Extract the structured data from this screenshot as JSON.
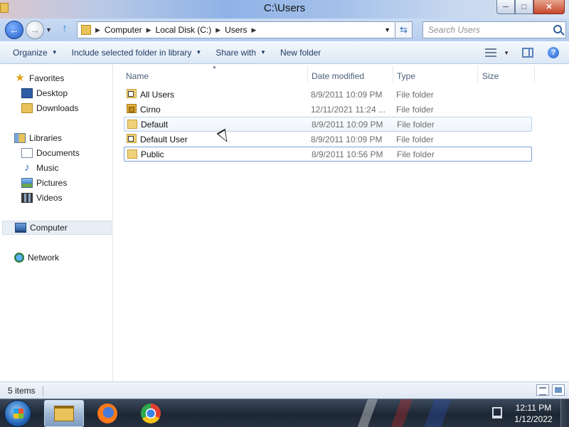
{
  "window": {
    "title": "C:\\Users",
    "buttons": {
      "min": "─",
      "max": "□",
      "close": "✕"
    }
  },
  "address": {
    "crumbs": [
      "Computer",
      "Local Disk (C:)",
      "Users"
    ],
    "search_placeholder": "Search Users"
  },
  "toolbar": {
    "organize": "Organize",
    "include": "Include selected folder in library",
    "share": "Share with",
    "new_folder": "New folder",
    "help": "?"
  },
  "nav": {
    "favorites": {
      "label": "Favorites",
      "items": [
        "Desktop",
        "Downloads"
      ]
    },
    "libraries": {
      "label": "Libraries",
      "items": [
        "Documents",
        "Music",
        "Pictures",
        "Videos"
      ]
    },
    "computer": "Computer",
    "network": "Network"
  },
  "columns": {
    "name": "Name",
    "date": "Date modified",
    "type": "Type",
    "size": "Size"
  },
  "files": [
    {
      "name": "All Users",
      "date": "8/9/2011 10:09 PM",
      "type": "File folder",
      "icon": "folder-shortcut-icon"
    },
    {
      "name": "Cirno",
      "date": "12/11/2021 11:24 ...",
      "type": "File folder",
      "icon": "folder-locked-icon"
    },
    {
      "name": "Default",
      "date": "8/9/2011 10:09 PM",
      "type": "File folder",
      "icon": "folder-icon"
    },
    {
      "name": "Default User",
      "date": "8/9/2011 10:09 PM",
      "type": "File folder",
      "icon": "folder-shortcut-icon"
    },
    {
      "name": "Public",
      "date": "8/9/2011 10:56 PM",
      "type": "File folder",
      "icon": "folder-icon"
    }
  ],
  "status": {
    "count": "5 items"
  },
  "taskbar": {
    "time": "12:11 PM",
    "date": "1/12/2022",
    "apps": [
      "windows-explorer",
      "firefox",
      "chrome"
    ]
  },
  "colors": {
    "selection_border": "#b9d1ea",
    "focus_border": "#7da2ce",
    "taskbar": "#1d2733"
  }
}
